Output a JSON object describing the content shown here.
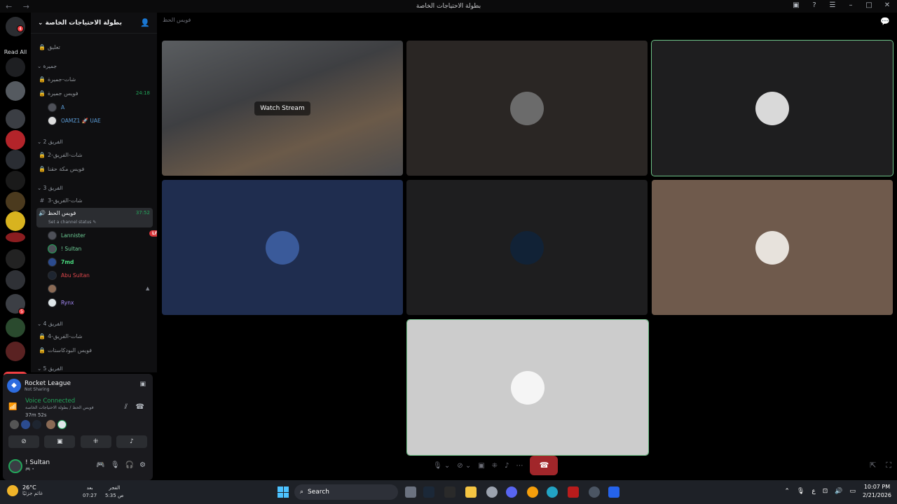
{
  "window": {
    "title": "بطولة الاحتياجات الخاصة",
    "nav": "← →"
  },
  "guilds": {
    "read_all": "Read All",
    "new_badge": "NEW",
    "ping_count": "4",
    "ping_count2": "5"
  },
  "server": {
    "name": "بطولة الاحتياجات الخاصة ⌄",
    "categories": [
      {
        "label": "جميرة ⌄"
      },
      {
        "label": "الفريق 2 ⌄"
      },
      {
        "label": "الفريق 3 ⌄"
      },
      {
        "label": "الفريق 4 ⌄"
      },
      {
        "label": "الفريق 5 ⌄"
      }
    ],
    "channels": {
      "c0": "تعليق",
      "c1": "شات-جميرة",
      "c2": "فويس جميرة",
      "c2_timer": "24:18",
      "c3": "شات-الفريق-2",
      "c4": "فويس مكة حقنا",
      "c5": "شات-الفريق-3",
      "c6": "فويس الحظ",
      "c6_timer": "37:52",
      "c6_status": "Set a channel status ✎",
      "c7": "شات-الفريق-4",
      "c8": "فويس البودكاستات"
    },
    "members_c2": [
      "A",
      "OAMZ1 🚀 UAE"
    ],
    "members_c6": [
      "Lannister",
      "! Sultan",
      "7md",
      "Abu Sultan",
      "",
      "Rynx"
    ],
    "live_badge": "LIVE"
  },
  "panel": {
    "game_name": "Rocket League",
    "game_status": "Not Sharing",
    "voice_title": "Voice Connected",
    "voice_path": "فويس الحظ / بطولة الاحتياجات الخاصة",
    "voice_duration": "37m  52s",
    "user_name": "! Sultan",
    "user_status": "🎮 •"
  },
  "main": {
    "channel_title": "فويس الحظ",
    "watch_stream": "Watch Stream"
  },
  "colors": {
    "speaking": "#6fc489",
    "tile_blue": "#1f2d4f",
    "tile_brown": "#6f5a4c",
    "tile_dark": "#1e1e1f",
    "tile_light": "#cccccc"
  },
  "taskbar": {
    "temp": "26°C",
    "weather_label": "غائم جزئيًا",
    "prayer1_name": "بعد",
    "prayer1_time": "07:27",
    "prayer2_name": "الفجر",
    "prayer2_time": "5:35 ص",
    "search": "Search",
    "lang": "ع",
    "time": "10:07 PM",
    "date": "2/21/2026"
  }
}
